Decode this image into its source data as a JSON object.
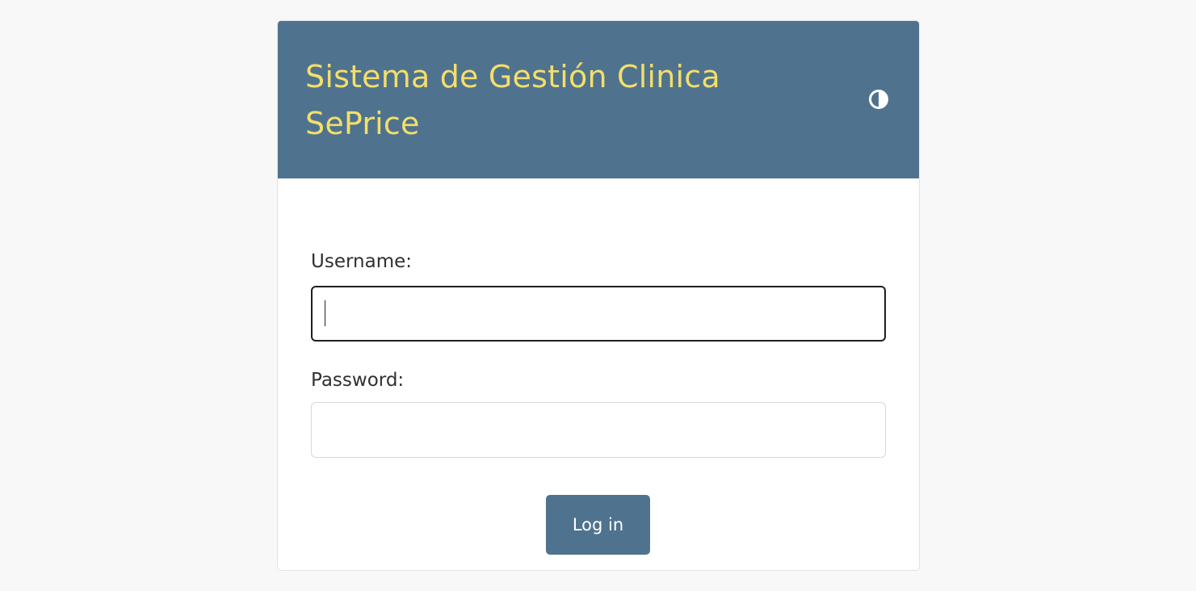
{
  "header": {
    "title": "Sistema de Gestión Clinica SePrice",
    "theme_toggle_icon": "half-circle-contrast-icon"
  },
  "login_form": {
    "username_label": "Username:",
    "username_value": "",
    "password_label": "Password:",
    "password_value": "",
    "submit_label": "Log in"
  },
  "colors": {
    "page_background": "#f8f8f8",
    "header_background": "#4f738e",
    "title_text": "#f4de6b",
    "button_background": "#4f738e",
    "button_text": "#ffffff",
    "focused_input_border": "#1f1f1f"
  }
}
